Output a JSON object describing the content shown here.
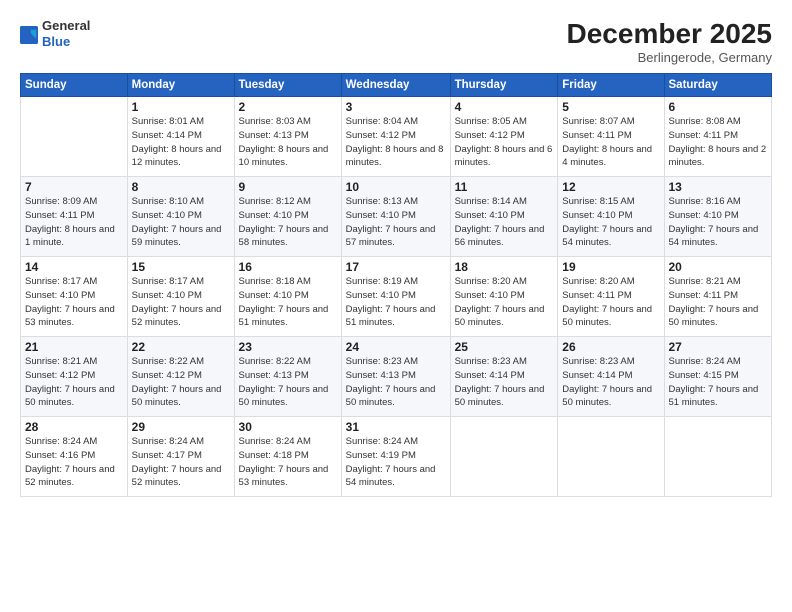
{
  "logo": {
    "general": "General",
    "blue": "Blue"
  },
  "header": {
    "month": "December 2025",
    "location": "Berlingerode, Germany"
  },
  "days_of_week": [
    "Sunday",
    "Monday",
    "Tuesday",
    "Wednesday",
    "Thursday",
    "Friday",
    "Saturday"
  ],
  "weeks": [
    [
      {
        "day": "",
        "sunrise": "",
        "sunset": "",
        "daylight": ""
      },
      {
        "day": "1",
        "sunrise": "Sunrise: 8:01 AM",
        "sunset": "Sunset: 4:14 PM",
        "daylight": "Daylight: 8 hours and 12 minutes."
      },
      {
        "day": "2",
        "sunrise": "Sunrise: 8:03 AM",
        "sunset": "Sunset: 4:13 PM",
        "daylight": "Daylight: 8 hours and 10 minutes."
      },
      {
        "day": "3",
        "sunrise": "Sunrise: 8:04 AM",
        "sunset": "Sunset: 4:12 PM",
        "daylight": "Daylight: 8 hours and 8 minutes."
      },
      {
        "day": "4",
        "sunrise": "Sunrise: 8:05 AM",
        "sunset": "Sunset: 4:12 PM",
        "daylight": "Daylight: 8 hours and 6 minutes."
      },
      {
        "day": "5",
        "sunrise": "Sunrise: 8:07 AM",
        "sunset": "Sunset: 4:11 PM",
        "daylight": "Daylight: 8 hours and 4 minutes."
      },
      {
        "day": "6",
        "sunrise": "Sunrise: 8:08 AM",
        "sunset": "Sunset: 4:11 PM",
        "daylight": "Daylight: 8 hours and 2 minutes."
      }
    ],
    [
      {
        "day": "7",
        "sunrise": "Sunrise: 8:09 AM",
        "sunset": "Sunset: 4:11 PM",
        "daylight": "Daylight: 8 hours and 1 minute."
      },
      {
        "day": "8",
        "sunrise": "Sunrise: 8:10 AM",
        "sunset": "Sunset: 4:10 PM",
        "daylight": "Daylight: 7 hours and 59 minutes."
      },
      {
        "day": "9",
        "sunrise": "Sunrise: 8:12 AM",
        "sunset": "Sunset: 4:10 PM",
        "daylight": "Daylight: 7 hours and 58 minutes."
      },
      {
        "day": "10",
        "sunrise": "Sunrise: 8:13 AM",
        "sunset": "Sunset: 4:10 PM",
        "daylight": "Daylight: 7 hours and 57 minutes."
      },
      {
        "day": "11",
        "sunrise": "Sunrise: 8:14 AM",
        "sunset": "Sunset: 4:10 PM",
        "daylight": "Daylight: 7 hours and 56 minutes."
      },
      {
        "day": "12",
        "sunrise": "Sunrise: 8:15 AM",
        "sunset": "Sunset: 4:10 PM",
        "daylight": "Daylight: 7 hours and 54 minutes."
      },
      {
        "day": "13",
        "sunrise": "Sunrise: 8:16 AM",
        "sunset": "Sunset: 4:10 PM",
        "daylight": "Daylight: 7 hours and 54 minutes."
      }
    ],
    [
      {
        "day": "14",
        "sunrise": "Sunrise: 8:17 AM",
        "sunset": "Sunset: 4:10 PM",
        "daylight": "Daylight: 7 hours and 53 minutes."
      },
      {
        "day": "15",
        "sunrise": "Sunrise: 8:17 AM",
        "sunset": "Sunset: 4:10 PM",
        "daylight": "Daylight: 7 hours and 52 minutes."
      },
      {
        "day": "16",
        "sunrise": "Sunrise: 8:18 AM",
        "sunset": "Sunset: 4:10 PM",
        "daylight": "Daylight: 7 hours and 51 minutes."
      },
      {
        "day": "17",
        "sunrise": "Sunrise: 8:19 AM",
        "sunset": "Sunset: 4:10 PM",
        "daylight": "Daylight: 7 hours and 51 minutes."
      },
      {
        "day": "18",
        "sunrise": "Sunrise: 8:20 AM",
        "sunset": "Sunset: 4:10 PM",
        "daylight": "Daylight: 7 hours and 50 minutes."
      },
      {
        "day": "19",
        "sunrise": "Sunrise: 8:20 AM",
        "sunset": "Sunset: 4:11 PM",
        "daylight": "Daylight: 7 hours and 50 minutes."
      },
      {
        "day": "20",
        "sunrise": "Sunrise: 8:21 AM",
        "sunset": "Sunset: 4:11 PM",
        "daylight": "Daylight: 7 hours and 50 minutes."
      }
    ],
    [
      {
        "day": "21",
        "sunrise": "Sunrise: 8:21 AM",
        "sunset": "Sunset: 4:12 PM",
        "daylight": "Daylight: 7 hours and 50 minutes."
      },
      {
        "day": "22",
        "sunrise": "Sunrise: 8:22 AM",
        "sunset": "Sunset: 4:12 PM",
        "daylight": "Daylight: 7 hours and 50 minutes."
      },
      {
        "day": "23",
        "sunrise": "Sunrise: 8:22 AM",
        "sunset": "Sunset: 4:13 PM",
        "daylight": "Daylight: 7 hours and 50 minutes."
      },
      {
        "day": "24",
        "sunrise": "Sunrise: 8:23 AM",
        "sunset": "Sunset: 4:13 PM",
        "daylight": "Daylight: 7 hours and 50 minutes."
      },
      {
        "day": "25",
        "sunrise": "Sunrise: 8:23 AM",
        "sunset": "Sunset: 4:14 PM",
        "daylight": "Daylight: 7 hours and 50 minutes."
      },
      {
        "day": "26",
        "sunrise": "Sunrise: 8:23 AM",
        "sunset": "Sunset: 4:14 PM",
        "daylight": "Daylight: 7 hours and 50 minutes."
      },
      {
        "day": "27",
        "sunrise": "Sunrise: 8:24 AM",
        "sunset": "Sunset: 4:15 PM",
        "daylight": "Daylight: 7 hours and 51 minutes."
      }
    ],
    [
      {
        "day": "28",
        "sunrise": "Sunrise: 8:24 AM",
        "sunset": "Sunset: 4:16 PM",
        "daylight": "Daylight: 7 hours and 52 minutes."
      },
      {
        "day": "29",
        "sunrise": "Sunrise: 8:24 AM",
        "sunset": "Sunset: 4:17 PM",
        "daylight": "Daylight: 7 hours and 52 minutes."
      },
      {
        "day": "30",
        "sunrise": "Sunrise: 8:24 AM",
        "sunset": "Sunset: 4:18 PM",
        "daylight": "Daylight: 7 hours and 53 minutes."
      },
      {
        "day": "31",
        "sunrise": "Sunrise: 8:24 AM",
        "sunset": "Sunset: 4:19 PM",
        "daylight": "Daylight: 7 hours and 54 minutes."
      },
      {
        "day": "",
        "sunrise": "",
        "sunset": "",
        "daylight": ""
      },
      {
        "day": "",
        "sunrise": "",
        "sunset": "",
        "daylight": ""
      },
      {
        "day": "",
        "sunrise": "",
        "sunset": "",
        "daylight": ""
      }
    ]
  ]
}
